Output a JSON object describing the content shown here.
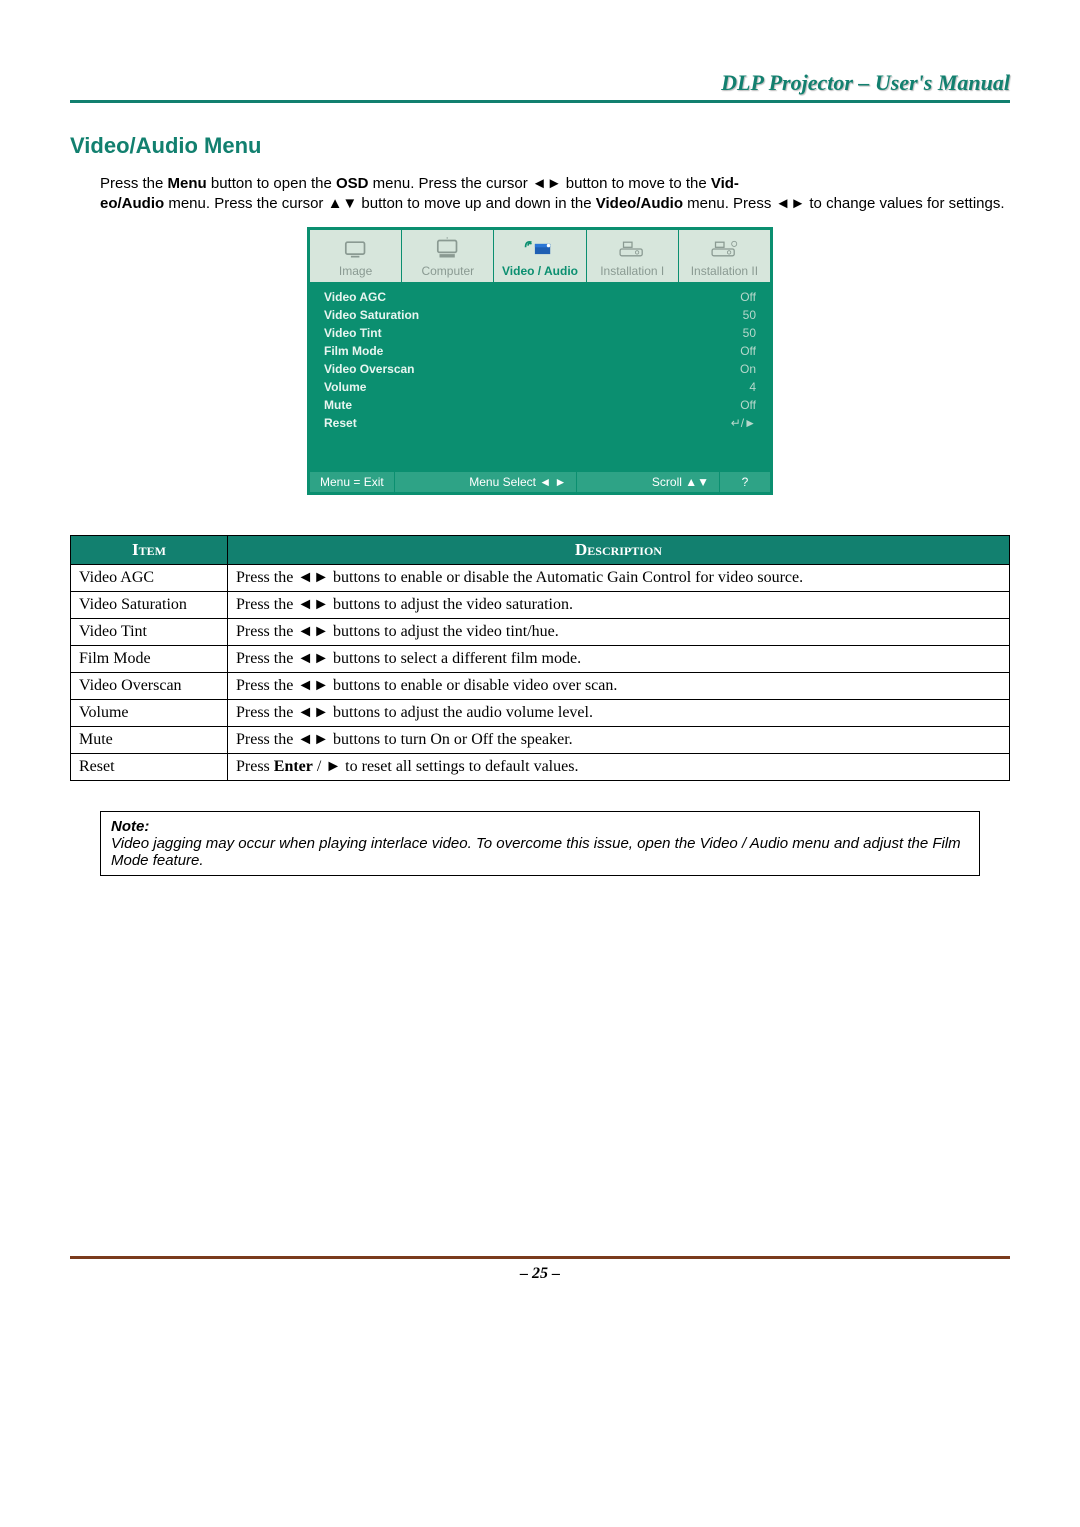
{
  "header": {
    "title": "DLP Projector – User's Manual"
  },
  "section": {
    "title": "Video/Audio Menu"
  },
  "intro": {
    "p1a": "Press the ",
    "menu_bold": "Menu",
    "p1b": " button to open the ",
    "osd_bold": "OSD",
    "p1c": " menu. Press the cursor ◄► button to move to the ",
    "va_bold1": "Vid-",
    "va_bold2": "eo/Audio",
    "p2a": " menu. Press the cursor ▲▼ button to move up and down in the ",
    "va_bold3": "Video/Audio",
    "p2b": " menu. Press ◄► to change values for settings."
  },
  "osd": {
    "tabs": [
      {
        "label": "Image",
        "active": false
      },
      {
        "label": "Computer",
        "active": false
      },
      {
        "label": "Video / Audio",
        "active": true
      },
      {
        "label": "Installation I",
        "active": false
      },
      {
        "label": "Installation II",
        "active": false
      }
    ],
    "rows": [
      {
        "label": "Video AGC",
        "value": "Off"
      },
      {
        "label": "Video Saturation",
        "value": "50"
      },
      {
        "label": "Video Tint",
        "value": "50"
      },
      {
        "label": "Film Mode",
        "value": "Off"
      },
      {
        "label": "Video Overscan",
        "value": "On"
      },
      {
        "label": "Volume",
        "value": "4"
      },
      {
        "label": "Mute",
        "value": "Off"
      },
      {
        "label": "Reset",
        "value": "↵/►"
      }
    ],
    "footer": {
      "exit": "Menu = Exit",
      "select": "Menu Select ◄ ►",
      "scroll": "Scroll ▲▼",
      "help": "?"
    }
  },
  "table": {
    "headers": {
      "item": "Item",
      "desc": "Description"
    },
    "rows": [
      {
        "item": "Video AGC",
        "desc": "Press the ◄► buttons to enable or disable the Automatic Gain Control for video source."
      },
      {
        "item": "Video Saturation",
        "desc": "Press the ◄► buttons to adjust the video saturation."
      },
      {
        "item": "Video Tint",
        "desc": "Press the ◄► buttons to adjust the video tint/hue."
      },
      {
        "item": "Film Mode",
        "desc": "Press the ◄► buttons to select a different film mode."
      },
      {
        "item": "Video Overscan",
        "desc": "Press the ◄► buttons to enable or disable video over scan."
      },
      {
        "item": "Volume",
        "desc": "Press the ◄► buttons to adjust the audio volume level."
      },
      {
        "item": "Mute",
        "desc": "Press the ◄► buttons to turn On or Off the speaker."
      }
    ],
    "reset": {
      "item": "Reset",
      "d1": "Press ",
      "enter_bold": "Enter",
      "d2": " / ► to reset all settings to default values."
    }
  },
  "note": {
    "title": "Note:",
    "body": "Video jagging may occur when playing interlace video. To overcome this issue, open the Video / Audio menu and adjust the Film Mode feature."
  },
  "footer": {
    "page": "– 25 –"
  }
}
